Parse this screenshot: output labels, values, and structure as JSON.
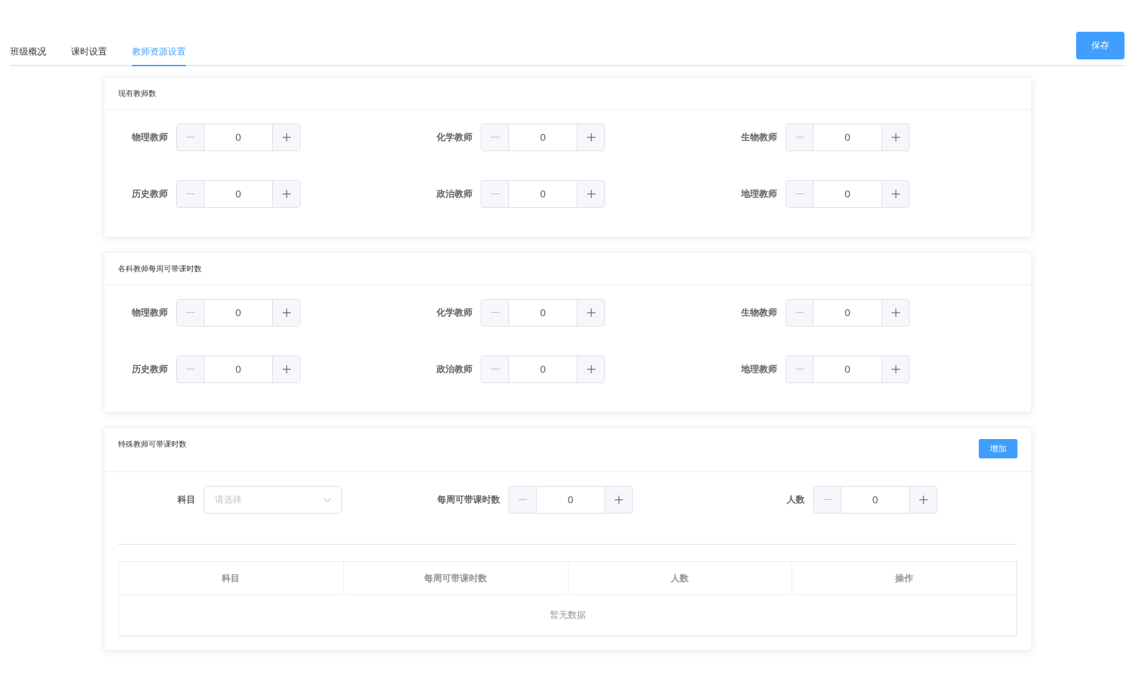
{
  "tabs": [
    {
      "label": "班级概况",
      "selected": false
    },
    {
      "label": "课时设置",
      "selected": false
    },
    {
      "label": "教师资源设置",
      "selected": true
    }
  ],
  "save_button": "保存",
  "sections": [
    {
      "title": "现有教师数",
      "fields": [
        {
          "label": "物理教师",
          "value": "0"
        },
        {
          "label": "化学教师",
          "value": "0"
        },
        {
          "label": "生物教师",
          "value": "0"
        },
        {
          "label": "历史教师",
          "value": "0"
        },
        {
          "label": "政治教师",
          "value": "0"
        },
        {
          "label": "地理教师",
          "value": "0"
        }
      ]
    },
    {
      "title": "各科教师每周可带课时数",
      "fields": [
        {
          "label": "物理教师",
          "value": "0"
        },
        {
          "label": "化学教师",
          "value": "0"
        },
        {
          "label": "生物教师",
          "value": "0"
        },
        {
          "label": "历史教师",
          "value": "0"
        },
        {
          "label": "政治教师",
          "value": "0"
        },
        {
          "label": "地理教师",
          "value": "0"
        }
      ]
    }
  ],
  "special": {
    "title": "特殊教师可带课时数",
    "add_button": "增加",
    "form": [
      {
        "kind": "select",
        "label": "科目",
        "placeholder": "请选择"
      },
      {
        "kind": "stepper",
        "label": "每周可带课时数",
        "value": "0"
      },
      {
        "kind": "stepper",
        "label": "人数",
        "value": "0"
      }
    ],
    "table": {
      "columns": [
        "科目",
        "每周可带课时数",
        "人数",
        "操作"
      ],
      "empty_text": "暂无数据"
    }
  }
}
